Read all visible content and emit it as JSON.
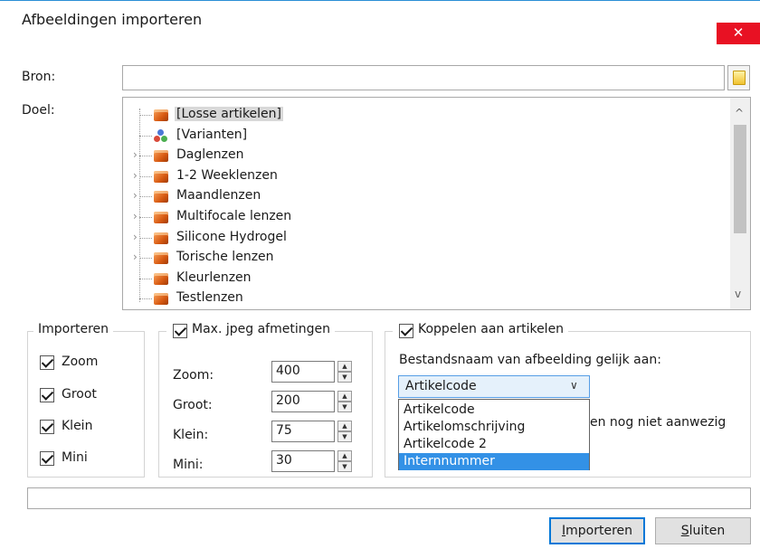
{
  "window": {
    "title": "Afbeeldingen importeren",
    "close_glyph": "✕"
  },
  "source": {
    "label": "Bron:",
    "value": "",
    "browse_icon": "folder-icon"
  },
  "target": {
    "label": "Doel:",
    "items": [
      {
        "label": "[Losse artikelen]",
        "icon": "cube-icon",
        "expandable": false,
        "selected": true
      },
      {
        "label": "[Varianten]",
        "icon": "molecule-icon",
        "expandable": false,
        "selected": false
      },
      {
        "label": "Daglenzen",
        "icon": "cube-icon",
        "expandable": true,
        "selected": false
      },
      {
        "label": "1-2 Weeklenzen",
        "icon": "cube-icon",
        "expandable": true,
        "selected": false
      },
      {
        "label": "Maandlenzen",
        "icon": "cube-icon",
        "expandable": true,
        "selected": false
      },
      {
        "label": "Multifocale lenzen",
        "icon": "cube-icon",
        "expandable": true,
        "selected": false
      },
      {
        "label": "Silicone Hydrogel",
        "icon": "cube-icon",
        "expandable": true,
        "selected": false
      },
      {
        "label": "Torische lenzen",
        "icon": "cube-icon",
        "expandable": true,
        "selected": false
      },
      {
        "label": "Kleurlenzen",
        "icon": "cube-icon",
        "expandable": false,
        "selected": false
      },
      {
        "label": "Testlenzen",
        "icon": "cube-icon",
        "expandable": false,
        "selected": false
      }
    ],
    "scroll_up_glyph": "^",
    "scroll_down_glyph": "v"
  },
  "import_group": {
    "legend": "Importeren",
    "options": [
      {
        "label": "Zoom",
        "checked": true
      },
      {
        "label": "Groot",
        "checked": true
      },
      {
        "label": "Klein",
        "checked": true
      },
      {
        "label": "Mini",
        "checked": true
      }
    ]
  },
  "jpeg_group": {
    "legend": "Max. jpeg afmetingen",
    "checked": true,
    "fields": [
      {
        "label": "Zoom:",
        "value": "400"
      },
      {
        "label": "Groot:",
        "value": "200"
      },
      {
        "label": "Klein:",
        "value": "75"
      },
      {
        "label": "Mini:",
        "value": "30"
      }
    ],
    "spin_up": "▲",
    "spin_down": "▼"
  },
  "link_group": {
    "legend": "Koppelen aan artikelen",
    "checked": true,
    "filename_label": "Bestandsnaam van afbeelding gelijk aan:",
    "selected": "Artikelcode",
    "combo_arrow": "∨",
    "options": [
      "Artikelcode",
      "Artikelomschrijving",
      "Artikelcode 2",
      "Internnummer"
    ],
    "highlighted_option": "Internnummer",
    "obscured_text": "en nog niet aanwezig"
  },
  "progress": {
    "value": 0
  },
  "buttons": {
    "import": {
      "mnemonic": "I",
      "rest": "mporteren"
    },
    "close": {
      "mnemonic": "S",
      "rest": "luiten"
    }
  }
}
